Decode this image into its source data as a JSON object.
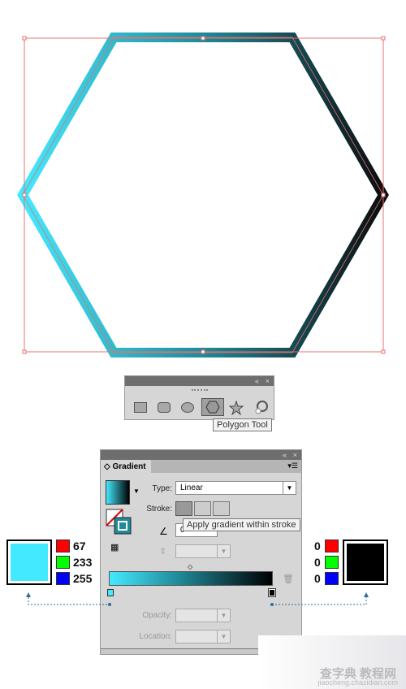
{
  "canvas": {
    "shape": "hexagon",
    "gradient_start": "#43e9ff",
    "gradient_end": "#000000",
    "bounding_box_color": "#e87070"
  },
  "polygon_panel": {
    "collapse_icon": "«",
    "close_icon": "×",
    "tools": [
      "rectangle-tool",
      "rounded-rectangle-tool",
      "ellipse-tool",
      "polygon-tool",
      "star-tool",
      "flare-tool"
    ],
    "selected_tool": "polygon-tool",
    "tooltip": "Polygon Tool"
  },
  "gradient_panel": {
    "collapse_icon": "«",
    "close_icon": "×",
    "tab": "Gradient",
    "tab_arrows": "◇",
    "type_label": "Type:",
    "type_value": "Linear",
    "stroke_label": "Stroke:",
    "stroke_tooltip": "Apply gradient within stroke",
    "angle_value": "0",
    "opacity_label": "Opacity:",
    "location_label": "Location:"
  },
  "left_color": {
    "hex": "#43e9ff",
    "r": "67",
    "g": "233",
    "b": "255"
  },
  "right_color": {
    "hex": "#000000",
    "r": "0",
    "g": "0",
    "b": "0"
  },
  "watermark": {
    "title": "查字典 教程网",
    "url": "jiaocheng.chazidian.com"
  }
}
